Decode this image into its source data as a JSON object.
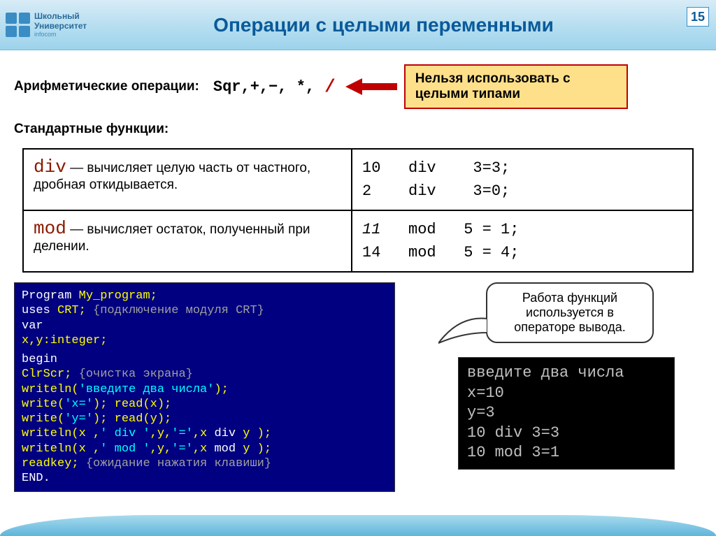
{
  "page_number": "15",
  "logo": {
    "line1": "Школьный",
    "line2": "Университет",
    "sub": "infocom"
  },
  "title": "Операции с целыми переменными",
  "arith_label": "Арифметические операции:",
  "arith_ops": "Sqr,+,−,  *,",
  "arith_slash": "/",
  "callout": "Нельзя использовать с целыми типами",
  "std_label": "Стандартные функции:",
  "funcs": [
    {
      "name": "div",
      "desc": " — вычисляет целую часть от частного, дробная откидывается.",
      "ex": "10   div    3=3;\n2    div    3=0;"
    },
    {
      "name": "mod",
      "desc": " — вычисляет остаток, полученный при делении.",
      "ex_prefix": "11",
      "ex_rest": "   mod   5 = 1;\n14   mod   5 = 4;"
    }
  ],
  "code": {
    "l1a": "Program",
    "l1b": " My_program;",
    "l2a": "uses",
    "l2b": " CRT;   ",
    "l2c": "{подключение модуля CRT}",
    "l3": "var",
    "l4": "   x,y:integer;",
    "l5": "begin",
    "l6a": "ClrScr;   ",
    "l6b": "{очистка экрана}",
    "l7a": "writeln(",
    "l7b": "'введите два числа'",
    "l7c": ");",
    "l8a": "write(",
    "l8b": "'x='",
    "l8c": ");  read(x);",
    "l9a": "write(",
    "l9b": "'y='",
    "l9c": ");  read(y);",
    "l10a": "writeln(x ,",
    "l10b": "' div '",
    "l10c": ",y,",
    "l10d": "'='",
    "l10e": ",x ",
    "l10f": "div",
    "l10g": " y );",
    "l11a": "writeln(x ,",
    "l11b": "' mod '",
    "l11c": ",y,",
    "l11d": "'='",
    "l11e": ",x ",
    "l11f": "mod",
    "l11g": " y );",
    "l12a": "readkey;   ",
    "l12b": "{ожидание нажатия клавиши}",
    "l13": "END."
  },
  "speech": "Работа функций используется в операторе вывода.",
  "console": "введите два числа\nx=10\ny=3\n10 div 3=3\n10 mod 3=1"
}
